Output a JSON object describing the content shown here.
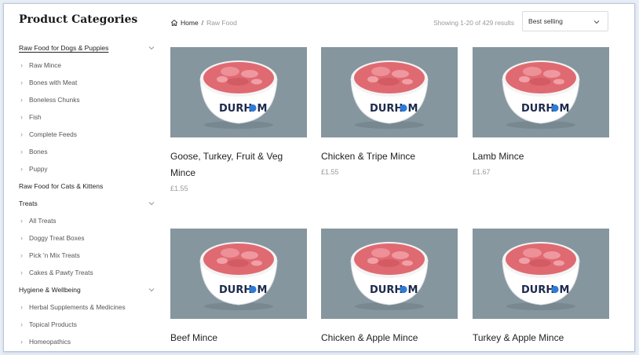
{
  "sidebar": {
    "title": "Product Categories",
    "groups": [
      {
        "label": "Raw Food for Dogs & Puppies",
        "items": [
          "Raw Mince",
          "Bones with Meat",
          "Boneless Chunks",
          "Fish",
          "Complete Feeds",
          "Bones",
          "Puppy"
        ]
      },
      {
        "label": "Raw Food for Cats & Kittens",
        "items": []
      },
      {
        "label": "Treats",
        "items": [
          "All Treats",
          "Doggy Treat Boxes",
          "Pick 'n Mix Treats",
          "Cakes & Pawty Treats"
        ]
      },
      {
        "label": "Hygiene & Wellbeing",
        "items": [
          "Herbal Supplements & Medicines",
          "Topical Products",
          "Homeopathics"
        ]
      }
    ]
  },
  "breadcrumb": {
    "home": "Home",
    "separator": "/",
    "current": "Raw Food"
  },
  "results": {
    "count_text": "Showing 1-20 of 429 results"
  },
  "sort": {
    "selected": "Best selling"
  },
  "bowl": {
    "brand_left": "DURH",
    "brand_right": "M"
  },
  "products": [
    {
      "name": "Goose, Turkey, Fruit & Veg Mince",
      "price": "£1.55"
    },
    {
      "name": "Chicken & Tripe Mince",
      "price": "£1.55"
    },
    {
      "name": "Lamb Mince",
      "price": "£1.67"
    },
    {
      "name": "Beef Mince",
      "price": ""
    },
    {
      "name": "Chicken & Apple Mince",
      "price": ""
    },
    {
      "name": "Turkey & Apple Mince",
      "price": ""
    }
  ],
  "colors": {
    "thumb_bg": "#86969f",
    "meat": "#e06a72",
    "bowl": "#ffffff",
    "brand": "#1d2a4d",
    "paw": "#2f7bd6"
  }
}
